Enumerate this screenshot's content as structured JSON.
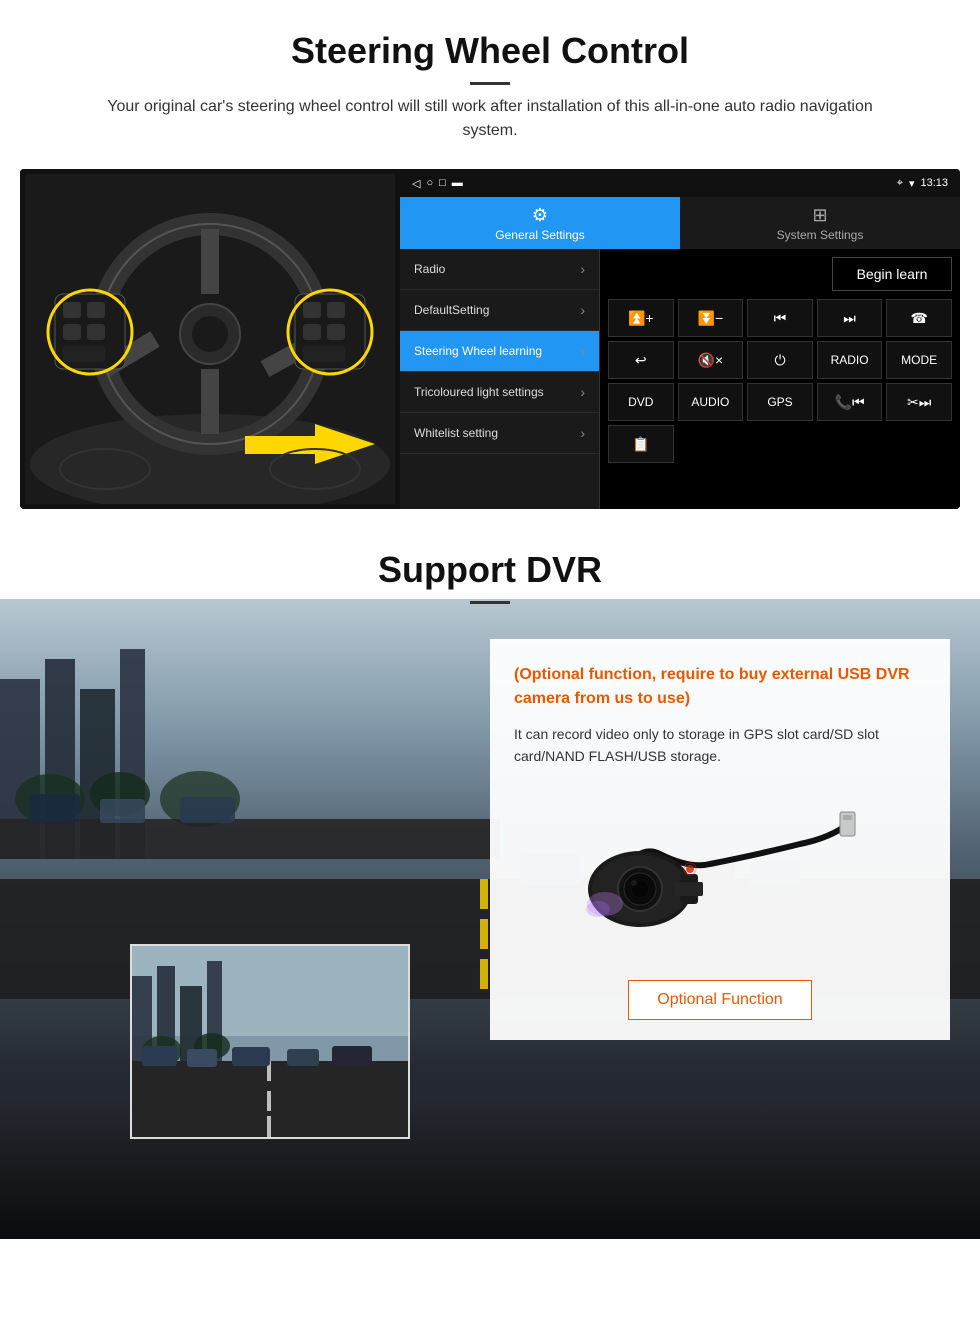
{
  "page": {
    "section1": {
      "title": "Steering Wheel Control",
      "description": "Your original car's steering wheel control will still work after installation of this all-in-one auto radio navigation system.",
      "statusbar": {
        "time": "13:13",
        "icons": "▽ ▿ □ ▬"
      },
      "tabs": {
        "general": "General Settings",
        "system": "System Settings"
      },
      "menu_items": [
        {
          "label": "Radio",
          "active": false
        },
        {
          "label": "DefaultSetting",
          "active": false
        },
        {
          "label": "Steering Wheel learning",
          "active": true
        },
        {
          "label": "Tricoloured light settings",
          "active": false
        },
        {
          "label": "Whitelist setting",
          "active": false
        }
      ],
      "begin_learn": "Begin learn",
      "controls": {
        "row1": [
          "⏮+",
          "⏮-",
          "⏮⏮",
          "⏭⏭",
          "☎"
        ],
        "row2": [
          "↩",
          "🔇x",
          "⏻",
          "RADIO",
          "MODE"
        ],
        "row3": [
          "DVD",
          "AUDIO",
          "GPS",
          "📞⏮",
          "✂⏭"
        ],
        "row4": [
          "📋"
        ]
      }
    },
    "section2": {
      "title": "Support DVR",
      "optional_text": "(Optional function, require to buy external USB DVR camera from us to use)",
      "body_text": "It can record video only to storage in GPS slot card/SD slot card/NAND FLASH/USB storage.",
      "optional_function_btn": "Optional Function"
    }
  }
}
